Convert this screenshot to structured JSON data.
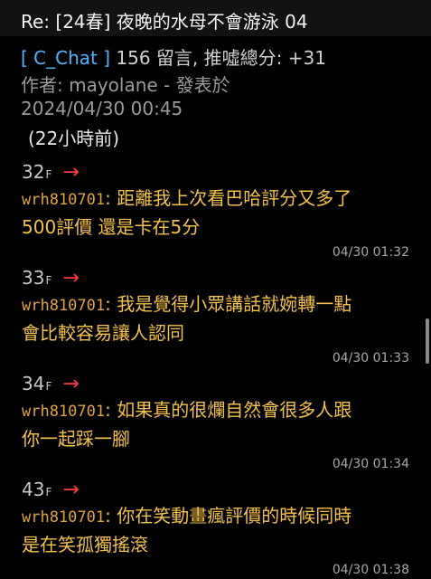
{
  "header": {
    "title": "Re: [24春] 夜晚的水母不會游泳 04"
  },
  "meta": {
    "board": "[ C_Chat ]",
    "stats": "156 留言, 推噓總分: +31",
    "author": "作者: mayolane - 發表於",
    "datetime": "2024/04/30 00:45",
    "relative": "(22小時前)"
  },
  "comments": [
    {
      "floor": "32",
      "floor_suffix": "F",
      "arrow": "→",
      "user": "wrh810701",
      "line1": ": 距離我上次看巴哈評分又多了",
      "line2": "500評價 還是卡在5分",
      "time": "04/30 01:32"
    },
    {
      "floor": "33",
      "floor_suffix": "F",
      "arrow": "→",
      "user": "wrh810701",
      "line1": ": 我是覺得小眾講話就婉轉一點",
      "line2": "會比較容易讓人認同",
      "time": "04/30 01:33"
    },
    {
      "floor": "34",
      "floor_suffix": "F",
      "arrow": "→",
      "user": "wrh810701",
      "line1": ": 如果真的很爛自然會很多人跟",
      "line2": "你一起踩一腳",
      "time": "04/30 01:34"
    },
    {
      "floor": "43",
      "floor_suffix": "F",
      "arrow": "→",
      "user": "wrh810701",
      "line1": ": 你在笑動畫瘋評價的時候同時",
      "line2": "是在笑孤獨搖滾",
      "time": "04/30 01:38"
    }
  ]
}
